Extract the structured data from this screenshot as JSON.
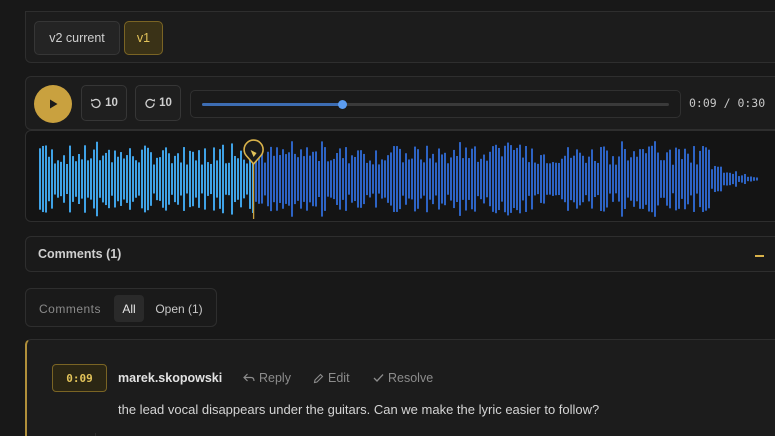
{
  "versions": {
    "v2_label": "v2 current",
    "v1_label": "v1",
    "active": "v1"
  },
  "player": {
    "play_icon": "play-icon",
    "skip_back_label": "10",
    "skip_forward_label": "10",
    "progress": 0.3,
    "time_readout": "0:09 / 0:30",
    "accent": "#c9a13f",
    "played_color": "#3fa2e6",
    "unplayed_color": "#2d63c4"
  },
  "waveform": {
    "marker_icon": "comment-marker-icon",
    "marker_time_fraction": 0.3
  },
  "comments_section": {
    "title": "Comments (1)",
    "collapse_icon": "minus-icon"
  },
  "filters": {
    "label": "Comments",
    "all": "All",
    "open": "Open (1)",
    "active": "All"
  },
  "comment": {
    "timestamp": "0:09",
    "author": "marek.skopowski",
    "reply": "Reply",
    "edit": "Edit",
    "resolve": "Resolve",
    "text": "the lead vocal disappears under the guitars. Can we make the lyric easier to follow?"
  }
}
